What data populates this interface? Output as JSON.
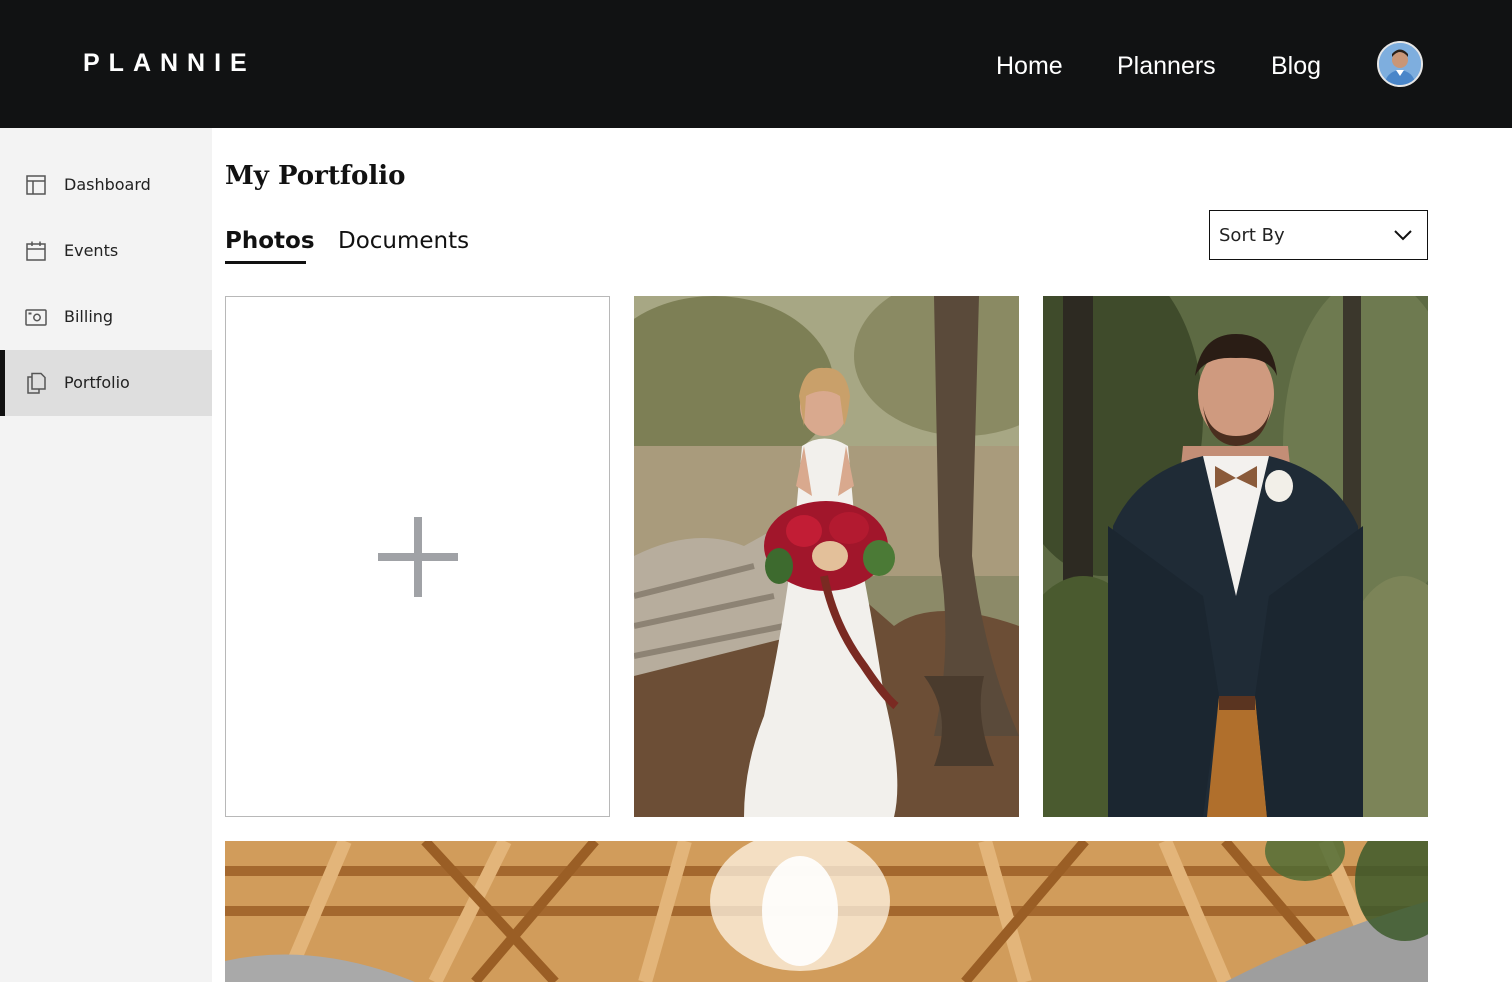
{
  "header": {
    "logo": "PLANNIE",
    "nav": {
      "home": "Home",
      "planners": "Planners",
      "blog": "Blog"
    },
    "avatar_icon": "user-avatar"
  },
  "sidebar": {
    "items": [
      {
        "label": "Dashboard",
        "icon": "dashboard-icon"
      },
      {
        "label": "Events",
        "icon": "calendar-icon"
      },
      {
        "label": "Billing",
        "icon": "billing-icon"
      },
      {
        "label": "Portfolio",
        "icon": "portfolio-icon",
        "active": true
      }
    ]
  },
  "main": {
    "title": "My Portfolio",
    "tabs": [
      {
        "label": "Photos",
        "active": true
      },
      {
        "label": "Documents",
        "active": false
      }
    ],
    "sort": {
      "label": "Sort By"
    },
    "add_tile_icon": "plus-icon"
  },
  "colors": {
    "header_bg": "#111213",
    "sidebar_bg": "#f3f3f3",
    "sidebar_active_bg": "#dedede",
    "accent": "#111111"
  }
}
